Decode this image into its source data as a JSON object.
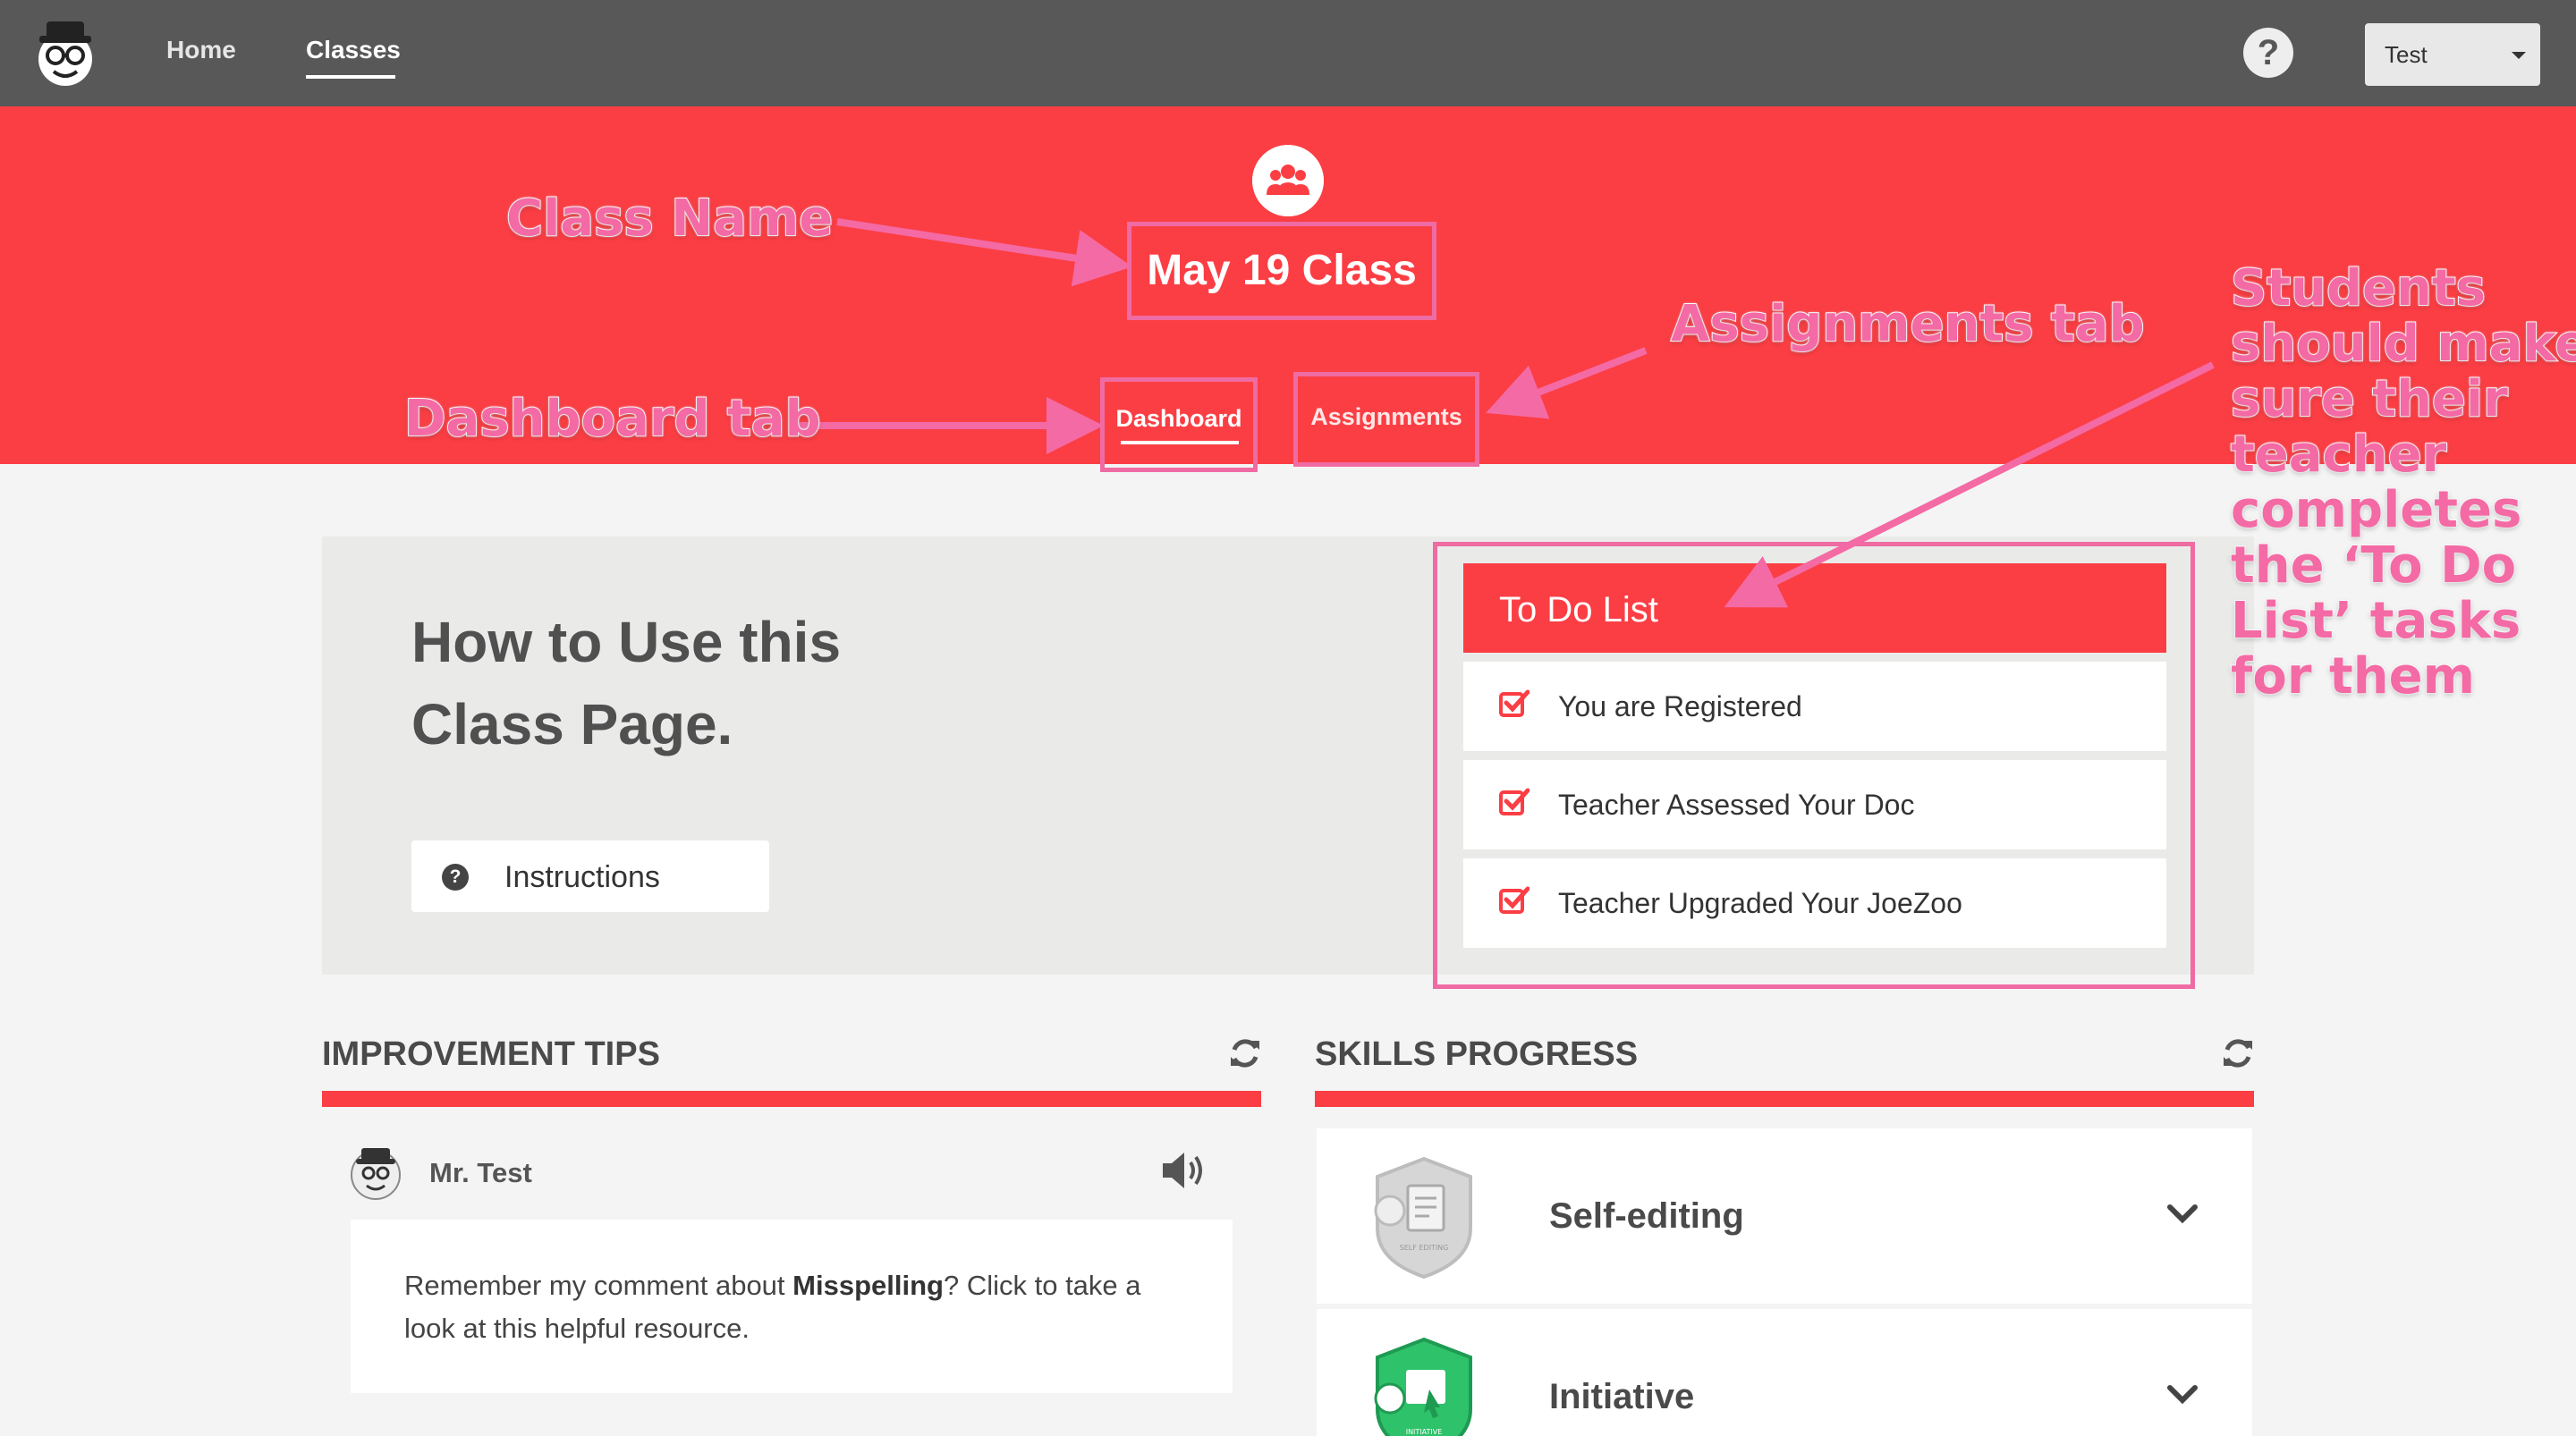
{
  "nav": {
    "home": "Home",
    "classes": "Classes",
    "help": "?",
    "user": "Test"
  },
  "header": {
    "class_name": "May 19 Class",
    "tabs": [
      {
        "label": "Dashboard",
        "active": true
      },
      {
        "label": "Assignments",
        "active": false
      }
    ]
  },
  "annotations": {
    "class_name": "Class Name",
    "dashboard_tab": "Dashboard tab",
    "assignments_tab": "Assignments tab",
    "students": [
      "Students",
      "should make",
      "sure their",
      "teacher",
      "completes",
      "the ‘To Do",
      "List’ tasks",
      "for them"
    ]
  },
  "intro": {
    "title": "How to Use this Class Page.",
    "instructions_button": "Instructions"
  },
  "todo": {
    "title": "To Do List",
    "items": [
      {
        "label": "You are Registered",
        "checked": true
      },
      {
        "label": "Teacher Assessed Your Doc",
        "checked": true
      },
      {
        "label": "Teacher Upgraded Your JoeZoo",
        "checked": true
      }
    ]
  },
  "improvement_tips": {
    "title": "IMPROVEMENT TIPS",
    "author": "Mr. Test",
    "tip_before": "Remember my comment about ",
    "tip_bold": "Misspelling",
    "tip_after": "? Click to take a look at this helpful resource."
  },
  "skills_progress": {
    "title": "SKILLS PROGRESS",
    "skills": [
      {
        "name": "Self-editing",
        "badge": "SELF EDITING"
      },
      {
        "name": "Initiative",
        "badge": "INITIATIVE"
      }
    ]
  },
  "colors": {
    "accent": "#fb3e44",
    "nav": "#585858",
    "annotation": "#f46aa5",
    "skill_green": "#2ec26a"
  }
}
